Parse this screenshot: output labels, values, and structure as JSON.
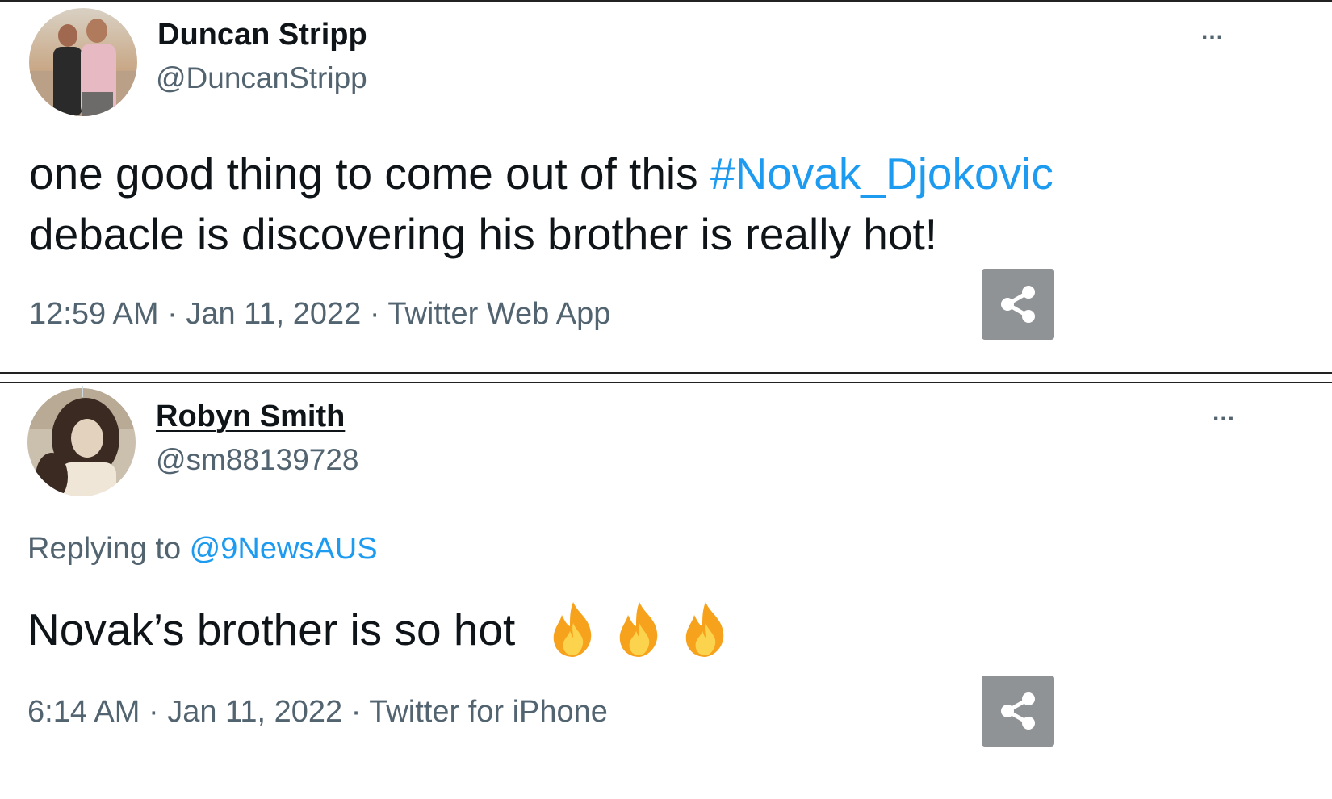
{
  "tweets": [
    {
      "name": "Duncan Stripp",
      "handle": "@DuncanStripp",
      "more": "...",
      "text_before": "one good thing to come out of this ",
      "hashtag": "#Novak_Djokovic",
      "text_line2": "debacle is discovering his brother is really hot!",
      "time": "12:59 AM",
      "date": "Jan 11, 2022",
      "source": "Twitter Web App",
      "separator": " · "
    },
    {
      "name": "Robyn Smith",
      "handle": "@sm88139728",
      "more": "...",
      "replying_prefix": "Replying to ",
      "replying_to": "@9NewsAUS",
      "text": "Novak’s brother is so hot ",
      "emoji": [
        "fire-icon",
        "fire-icon",
        "fire-icon"
      ],
      "time": "6:14 AM",
      "date": "Jan 11, 2022",
      "source": "Twitter for iPhone",
      "separator": " · "
    }
  ],
  "colors": {
    "link": "#1d9bf0",
    "muted": "#536471",
    "text": "#0f1419",
    "share_button": "#8f9396"
  }
}
